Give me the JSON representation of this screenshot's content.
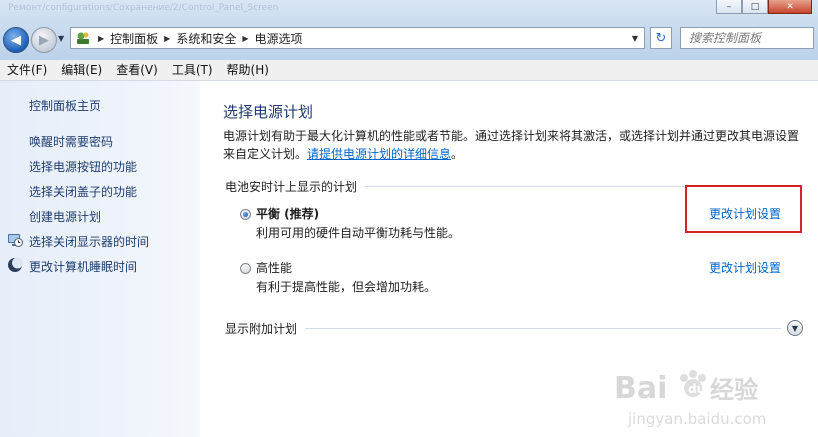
{
  "window": {
    "ghost_title": "Ремонт/configurations/Сохранение/2/Control_Panel_Screen",
    "minimize_glyph": "–",
    "maximize_glyph": "□",
    "close_glyph": "✕"
  },
  "address": {
    "crumbs": [
      "控制面板",
      "系统和安全",
      "电源选项"
    ],
    "search_placeholder": "搜索控制面板"
  },
  "menu": [
    "文件(F)",
    "编辑(E)",
    "查看(V)",
    "工具(T)",
    "帮助(H)"
  ],
  "sidebar": {
    "home": "控制面板主页",
    "links": [
      "唤醒时需要密码",
      "选择电源按钮的功能",
      "选择关闭盖子的功能",
      "创建电源计划",
      "选择关闭显示器的时间",
      "更改计算机睡眠时间"
    ]
  },
  "main": {
    "title": "选择电源计划",
    "description": "电源计划有助于最大化计算机的性能或者节能。通过选择计划来将其激活，或选择计划并通过更改其电源设置来自定义计划。",
    "description_link": "请提供电源计划的详细信息",
    "description_end": "。",
    "group_title": "电池安时计上显示的计划",
    "plans": [
      {
        "name": "平衡 (推荐)",
        "desc": "利用可用的硬件自动平衡功耗与性能。",
        "link": "更改计划设置",
        "selected": true
      },
      {
        "name": "高性能",
        "desc": "有利于提高性能，但会增加功耗。",
        "link": "更改计划设置",
        "selected": false
      }
    ],
    "extra_plans": "显示附加计划"
  },
  "watermark": {
    "brand": "Bai",
    "cn": "经验",
    "url": "jingyan.baidu.com"
  },
  "colors": {
    "link": "#0066cc",
    "title": "#1e3b6e",
    "highlight": "#d9202a",
    "sidebar_link": "#1e3d70"
  }
}
